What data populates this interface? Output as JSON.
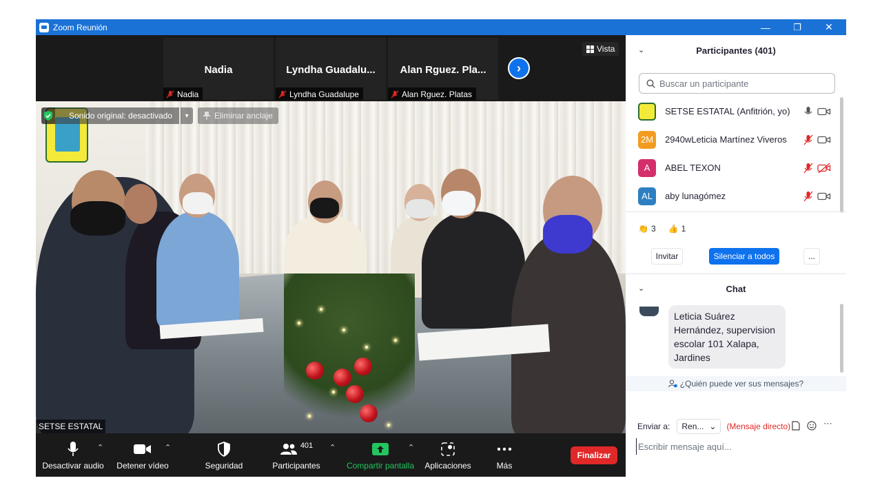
{
  "window": {
    "title": "Zoom Reunión",
    "minimize": "—",
    "restore": "❐",
    "close": "✕"
  },
  "thumbnails": [
    {
      "display_name": "Nadia",
      "label": "Nadia"
    },
    {
      "display_name": "Lyndha  Guadalu...",
      "label": "Lyndha Guadalupe"
    },
    {
      "display_name": "Alan  Rguez. Pla...",
      "label": "Alan  Rguez. Platas"
    }
  ],
  "view_button": {
    "label": "Vista"
  },
  "video": {
    "sound_original": "Sonido original: desactivado",
    "unpin": "Eliminar anclaje",
    "speaker_name": "SETSE ESTATAL"
  },
  "toolbar": {
    "mute": "Desactivar audio",
    "video": "Detener vídeo",
    "security": "Seguridad",
    "participants": "Participantes",
    "participants_count": "401",
    "share": "Compartir pantalla",
    "apps": "Aplicaciones",
    "more": "Más",
    "end": "Finalizar"
  },
  "participants_panel": {
    "title": "Participantes (401)",
    "search_placeholder": "Buscar un participante",
    "list": [
      {
        "initials": "",
        "name": "SETSE ESTATAL (Anfitrión, yo)",
        "color": "#f4ea3a",
        "mic": "on",
        "cam": "on"
      },
      {
        "initials": "2M",
        "name": "2940wLeticia Martínez Viveros",
        "color": "#f29c1f",
        "mic": "off",
        "cam": "on"
      },
      {
        "initials": "A",
        "name": "ABEL TEXON",
        "color": "#d32f6b",
        "mic": "off",
        "cam": "off"
      },
      {
        "initials": "AL",
        "name": "aby lunagómez",
        "color": "#2d7fc1",
        "mic": "off",
        "cam": "on"
      }
    ],
    "reactions": [
      {
        "emoji": "👏",
        "count": "3"
      },
      {
        "emoji": "👍",
        "count": "1"
      }
    ],
    "invite": "Invitar",
    "mute_all": "Silenciar a todos",
    "more": "..."
  },
  "chat_panel": {
    "title": "Chat",
    "message": "Leticia Suárez Hernández, supervision escolar 101 Xalapa, Jardines",
    "who_can_see": "¿Quién puede ver sus mensajes?",
    "send_to_label": "Enviar a:",
    "recipient": "Ren...",
    "direct": "(Mensaje directo)",
    "input_placeholder": "Escribir mensaje aquí..."
  },
  "colors": {
    "titlebar": "#1a72d6",
    "accent": "#0e72ed",
    "end": "#e02828",
    "share": "#23c55e"
  }
}
